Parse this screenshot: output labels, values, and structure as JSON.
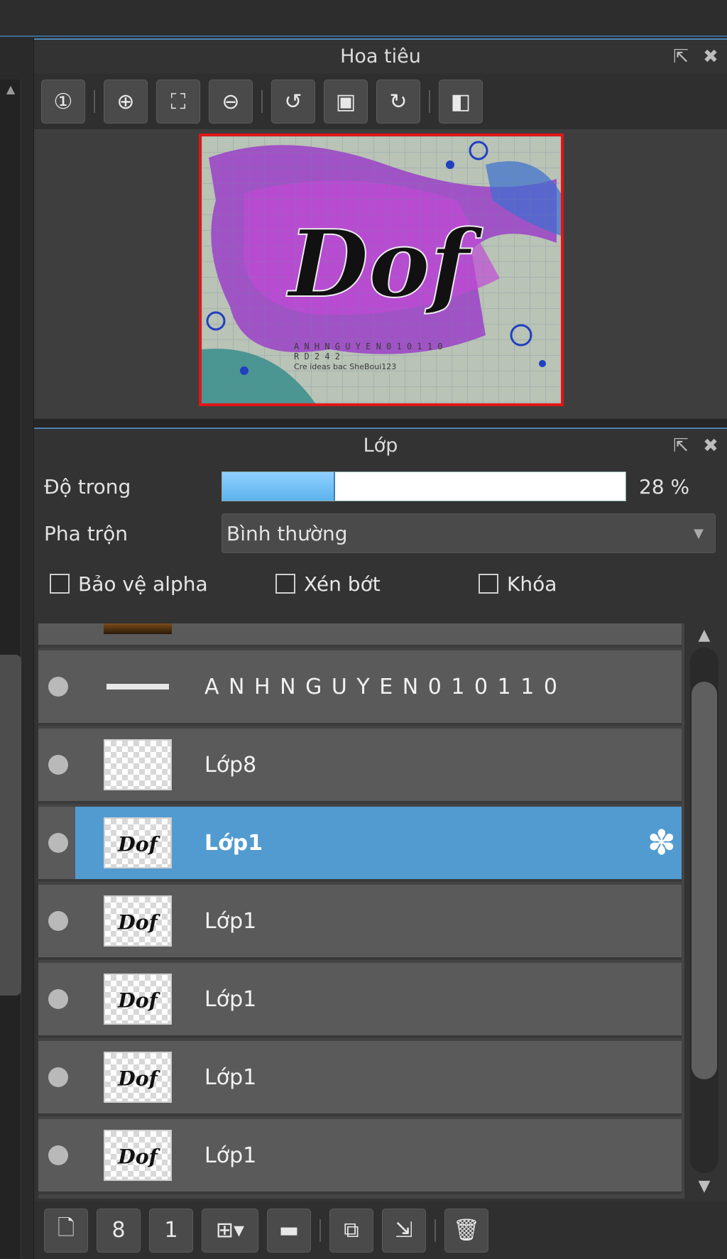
{
  "navigator": {
    "title": "Hoa tiêu",
    "toolbar": [
      {
        "icon": "zoom-actual-icon",
        "glyph": "①"
      },
      {
        "icon": "zoom-in-icon",
        "glyph": "⊕"
      },
      {
        "icon": "fit-screen-icon",
        "glyph": "⛶"
      },
      {
        "icon": "zoom-out-icon",
        "glyph": "⊖"
      },
      {
        "icon": "rotate-left-icon",
        "glyph": "↺"
      },
      {
        "icon": "fit-canvas-icon",
        "glyph": "▣"
      },
      {
        "icon": "rotate-right-icon",
        "glyph": "↻"
      },
      {
        "icon": "flip-horizontal-icon",
        "glyph": "◧"
      }
    ],
    "preview_title_text": "Dof",
    "preview_caption_1": "A N H N G U Y E N 0 1 0 1 1 0",
    "preview_caption_2": "R D 2 4 2",
    "preview_caption_3": "Cre ideas bac SheBoui123"
  },
  "layers_panel": {
    "title": "Lớp",
    "opacity_label": "Độ trong",
    "opacity_value": "28 %",
    "opacity_fraction": 0.28,
    "blend_label": "Pha trộn",
    "blend_value": "Bình thường",
    "checks": {
      "protect_alpha": "Bảo vệ alpha",
      "clipping": "Xén bớt",
      "lock": "Khóa"
    },
    "layers": [
      {
        "name": "",
        "thumb": "photo",
        "selected": false
      },
      {
        "name": "A N H N G U Y E N 0 1 0 1 1 0",
        "thumb": "text",
        "selected": false
      },
      {
        "name": "Lớp8",
        "thumb": "empty",
        "selected": false
      },
      {
        "name": "Lớp1",
        "thumb": "dof",
        "selected": true
      },
      {
        "name": "Lớp1",
        "thumb": "dof",
        "selected": false
      },
      {
        "name": "Lớp1",
        "thumb": "dof",
        "selected": false
      },
      {
        "name": "Lớp1",
        "thumb": "dof",
        "selected": false
      },
      {
        "name": "Lớp1",
        "thumb": "dof",
        "selected": false
      }
    ],
    "bottom_toolbar": [
      {
        "icon": "new-layer-icon",
        "glyph": "🗋"
      },
      {
        "icon": "new-8bit-layer-icon",
        "glyph": "8"
      },
      {
        "icon": "new-1bit-layer-icon",
        "glyph": "1"
      },
      {
        "icon": "add-layer-menu-icon",
        "glyph": "⊞▾"
      },
      {
        "icon": "new-folder-icon",
        "glyph": "▬"
      },
      {
        "icon": "duplicate-layer-icon",
        "glyph": "⧉"
      },
      {
        "icon": "merge-down-icon",
        "glyph": "⇲"
      },
      {
        "icon": "delete-layer-icon",
        "glyph": "🗑"
      }
    ]
  }
}
